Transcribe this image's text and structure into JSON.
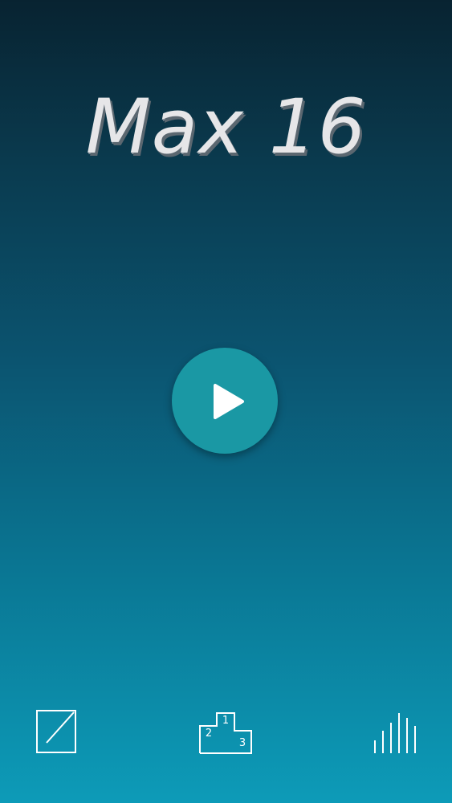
{
  "header": {
    "title": "Max 16"
  },
  "main": {
    "play_icon": "play-icon"
  },
  "bottom_bar": {
    "edit_icon": "edit-icon",
    "podium_icon": "leaderboard-podium-icon",
    "podium_places": [
      "1",
      "2",
      "3"
    ],
    "stats_icon": "stats-bars-icon"
  },
  "colors": {
    "gradient_top": "#082331",
    "gradient_bottom": "#0d9bb8",
    "play_button": "#1a98a4",
    "title_text": "#e6e6e8",
    "icon_stroke": "#ffffff"
  }
}
